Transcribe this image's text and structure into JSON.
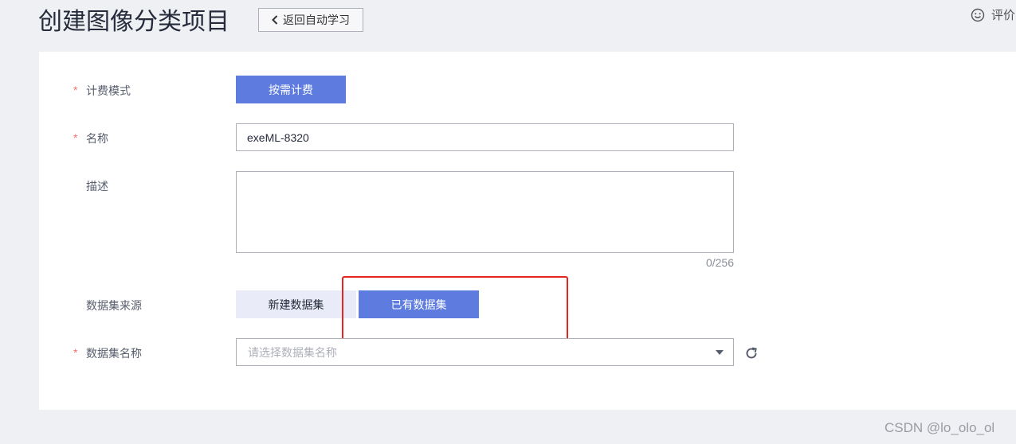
{
  "header": {
    "title": "创建图像分类项目",
    "back_label": "返回自动学习",
    "feedback_label": "评价"
  },
  "form": {
    "required_mark": "*",
    "billing": {
      "label": "计费模式",
      "option": "按需计费"
    },
    "name": {
      "label": "名称",
      "value": "exeML-8320"
    },
    "description": {
      "label": "描述",
      "value": "",
      "counter": "0/256"
    },
    "dataset_source": {
      "label": "数据集来源",
      "options": [
        "新建数据集",
        "已有数据集"
      ],
      "selected": "已有数据集"
    },
    "dataset_name": {
      "label": "数据集名称",
      "placeholder": "请选择数据集名称"
    }
  },
  "watermark": "CSDN @lo_olo_ol",
  "colors": {
    "primary": "#5e7ce0",
    "required": "#f66f6a",
    "highlight": "#e5251f",
    "background": "#eff0f4"
  }
}
